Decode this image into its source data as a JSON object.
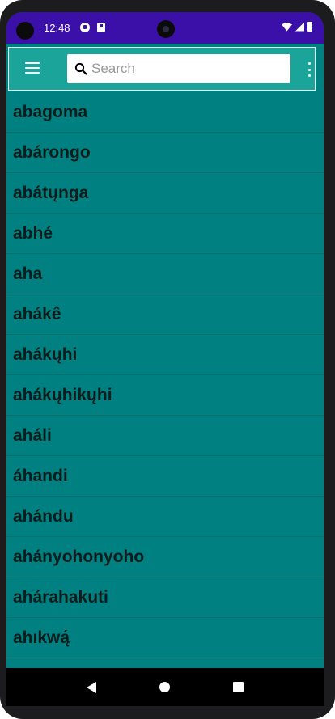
{
  "status_bar": {
    "time": "12:48"
  },
  "toolbar": {
    "search_placeholder": "Search",
    "search_value": ""
  },
  "words": [
    "abagoma",
    "abárongo",
    "abátųnga",
    "abhé",
    "aha",
    "ahákê",
    "ahákųhi",
    "ahákųhikųhi",
    "aháli",
    "áhandi",
    "ahándu",
    "ahányohonyoho",
    "ahárahakuti",
    "ahıkwą́"
  ],
  "colors": {
    "status_bar": "#3a10a8",
    "toolbar": "#1ba59a",
    "list_background": "#008080",
    "nav_bar": "#000000"
  },
  "icons": [
    "menu-icon",
    "search-icon",
    "overflow-menu-icon",
    "back-icon",
    "home-icon",
    "recents-icon"
  ]
}
